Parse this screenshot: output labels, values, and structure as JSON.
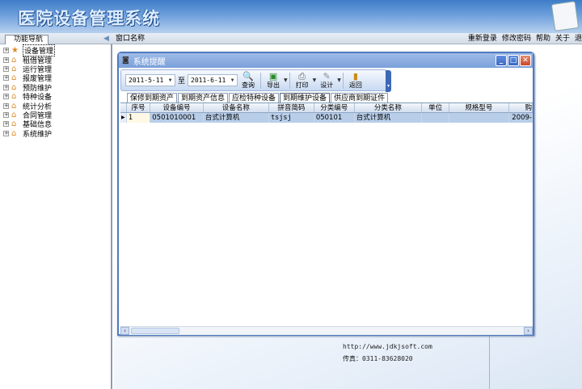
{
  "app": {
    "title": "医院设备管理系统"
  },
  "navbar": {
    "nav_tab": "功能导航",
    "window_name": "窗口名称",
    "links": [
      "重新登录",
      "修改密码",
      "帮助",
      "关于",
      "退"
    ]
  },
  "sidebar": {
    "items": [
      {
        "label": "设备管理",
        "selected": true
      },
      {
        "label": "租借管理"
      },
      {
        "label": "运行管理"
      },
      {
        "label": "报废管理"
      },
      {
        "label": "预防维护"
      },
      {
        "label": "特种设备"
      },
      {
        "label": "统计分析"
      },
      {
        "label": "合同管理"
      },
      {
        "label": "基础信息"
      },
      {
        "label": "系统维护"
      }
    ]
  },
  "background_info": {
    "url": "http://www.jdkjsoft.com",
    "fax": "传真：0311-83628020"
  },
  "dialog": {
    "title": "系统提醒",
    "toolbar": {
      "date_from": "2011-5-11",
      "to_label": "至",
      "date_to": "2011-6-11",
      "query": "查询",
      "export": "导出",
      "print": "打印",
      "design": "设计",
      "back": "返回"
    },
    "tabs": [
      "保修到期资产",
      "到期资产信息",
      "应检特种设备",
      "到期维护设备",
      "供应商到期证件"
    ],
    "active_tab": 3,
    "columns": [
      "序号",
      "设备编号",
      "设备名称",
      "拼音简码",
      "分类编号",
      "分类名称",
      "单位",
      "规格型号",
      "购"
    ],
    "rows": [
      [
        "1",
        "0501010001",
        "台式计算机",
        "tsjsj",
        "050101",
        "台式计算机",
        "",
        "",
        "2009-"
      ]
    ]
  }
}
